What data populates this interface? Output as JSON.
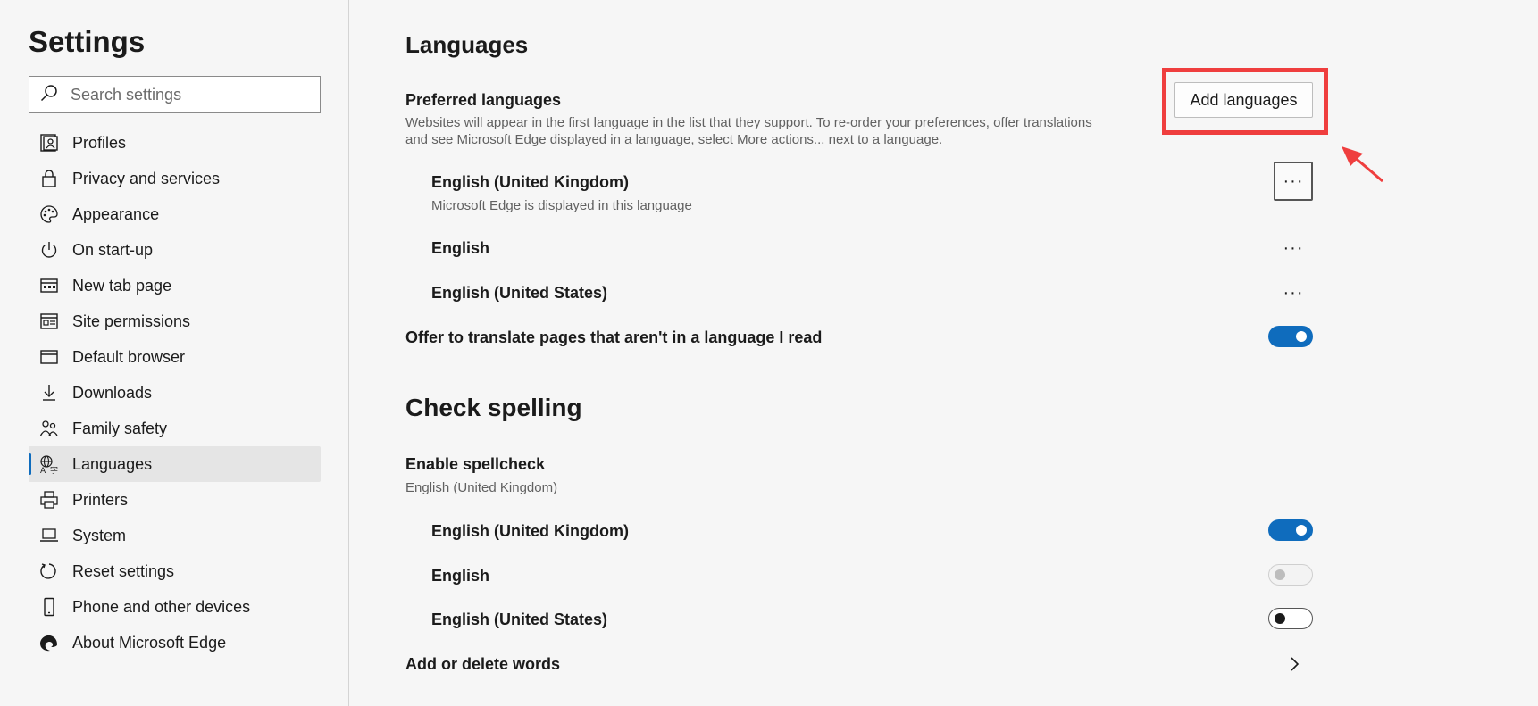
{
  "sidebar": {
    "title": "Settings",
    "search_placeholder": "Search settings",
    "items": [
      {
        "label": "Profiles",
        "icon": "profile-icon"
      },
      {
        "label": "Privacy and services",
        "icon": "lock-icon"
      },
      {
        "label": "Appearance",
        "icon": "palette-icon"
      },
      {
        "label": "On start-up",
        "icon": "power-icon"
      },
      {
        "label": "New tab page",
        "icon": "new-tab-icon"
      },
      {
        "label": "Site permissions",
        "icon": "site-permissions-icon"
      },
      {
        "label": "Default browser",
        "icon": "browser-icon"
      },
      {
        "label": "Downloads",
        "icon": "download-icon"
      },
      {
        "label": "Family safety",
        "icon": "family-icon"
      },
      {
        "label": "Languages",
        "icon": "languages-icon",
        "active": true
      },
      {
        "label": "Printers",
        "icon": "printer-icon"
      },
      {
        "label": "System",
        "icon": "laptop-icon"
      },
      {
        "label": "Reset settings",
        "icon": "reset-icon"
      },
      {
        "label": "Phone and other devices",
        "icon": "phone-icon"
      },
      {
        "label": "About Microsoft Edge",
        "icon": "edge-icon"
      }
    ]
  },
  "languages": {
    "heading": "Languages",
    "preferred_title": "Preferred languages",
    "preferred_desc_line1": "Websites will appear in the first language in the list that they support. To re-order your preferences, offer translations",
    "preferred_desc_line2": "and see Microsoft Edge displayed in a language, select More actions... next to a language.",
    "add_button": "Add languages",
    "list": [
      {
        "name": "English (United Kingdom)",
        "sub": "Microsoft Edge is displayed in this language"
      },
      {
        "name": "English",
        "sub": ""
      },
      {
        "name": "English (United States)",
        "sub": ""
      }
    ],
    "more_actions": "···",
    "translate_label": "Offer to translate pages that aren't in a language I read",
    "translate_on": true
  },
  "spelling": {
    "heading": "Check spelling",
    "enable_title": "Enable spellcheck",
    "enable_sub": "English (United Kingdom)",
    "items": [
      {
        "name": "English (United Kingdom)",
        "state": "on"
      },
      {
        "name": "English",
        "state": "disabled"
      },
      {
        "name": "English (United States)",
        "state": "off"
      }
    ],
    "add_delete_words": "Add or delete words"
  },
  "colors": {
    "accent": "#0f6cbd",
    "annotation": "#ef3e3e"
  }
}
